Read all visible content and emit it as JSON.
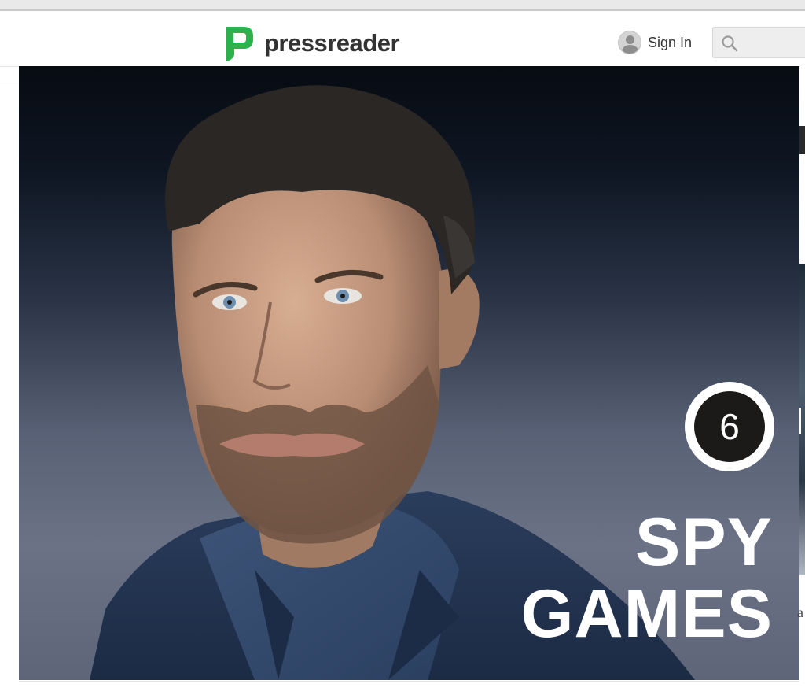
{
  "header": {
    "logo_text": "pressreader",
    "signin_label": "Sign In",
    "search_placeholder": ""
  },
  "article": {
    "badge_number": "6",
    "headline_line1": "SPY",
    "headline_line2": "GAMES"
  },
  "right_strip": {
    "text_fragment": "a"
  },
  "colors": {
    "brand_green": "#2bb24c",
    "text_dark": "#333333"
  }
}
